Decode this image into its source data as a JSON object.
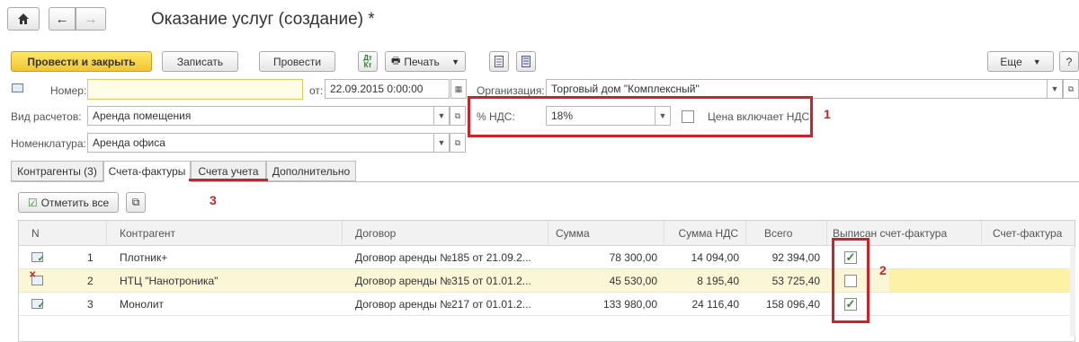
{
  "window": {
    "title": "Оказание услуг (создание) *"
  },
  "toolbar": {
    "post_close": "Провести и закрыть",
    "save": "Записать",
    "post": "Провести",
    "print": "Печать",
    "more": "Еще",
    "help": "?"
  },
  "form": {
    "number_label": "Номер:",
    "number_value": "",
    "date_label": "от:",
    "date_value": "22.09.2015  0:00:00",
    "org_label": "Организация:",
    "org_value": "Торговый дом \"Комплексный\"",
    "calc_type_label": "Вид расчетов:",
    "calc_type_value": "Аренда помещения",
    "vat_label": "% НДС:",
    "vat_value": "18%",
    "price_incl_vat_label": "Цена включает НДС",
    "price_incl_vat_checked": false,
    "nomenclature_label": "Номенклатура:",
    "nomenclature_value": "Аренда офиса"
  },
  "tabs": [
    {
      "label": "Контрагенты (3)"
    },
    {
      "label": "Счета-фактуры"
    },
    {
      "label": "Счета учета"
    },
    {
      "label": "Дополнительно"
    }
  ],
  "invoices": {
    "mark_all": "Отметить все",
    "columns": [
      "N",
      "Контрагент",
      "Договор",
      "Сумма",
      "Сумма НДС",
      "Всего",
      "Выписан счет-фактура",
      "Счет-фактура"
    ],
    "rows": [
      {
        "n": "1",
        "contractor": "Плотник+",
        "contract": "Договор аренды №185 от 21.09.2...",
        "sum": "78 300,00",
        "vat": "14 094,00",
        "total": "92 394,00",
        "issued": true,
        "invoice": "",
        "status_icon": "document-ok-icon"
      },
      {
        "n": "2",
        "contractor": "НТЦ \"Нанотроника\"",
        "contract": "Договор аренды №315 от 01.01.2...",
        "sum": "45 530,00",
        "vat": "8 195,40",
        "total": "53 725,40",
        "issued": false,
        "invoice": "",
        "status_icon": "document-error-icon"
      },
      {
        "n": "3",
        "contractor": "Монолит",
        "contract": "Договор аренды №217 от 01.01.2...",
        "sum": "133 980,00",
        "vat": "24 116,40",
        "total": "158 096,40",
        "issued": true,
        "invoice": "",
        "status_icon": "document-ok-icon"
      }
    ]
  },
  "annotations": {
    "a1": "1",
    "a2": "2",
    "a3": "3"
  },
  "colors": {
    "annotation": "#d0202a",
    "primary_button": "#f2c530",
    "selected_row": "#fbf6d5",
    "check": "#2e8b2e"
  }
}
